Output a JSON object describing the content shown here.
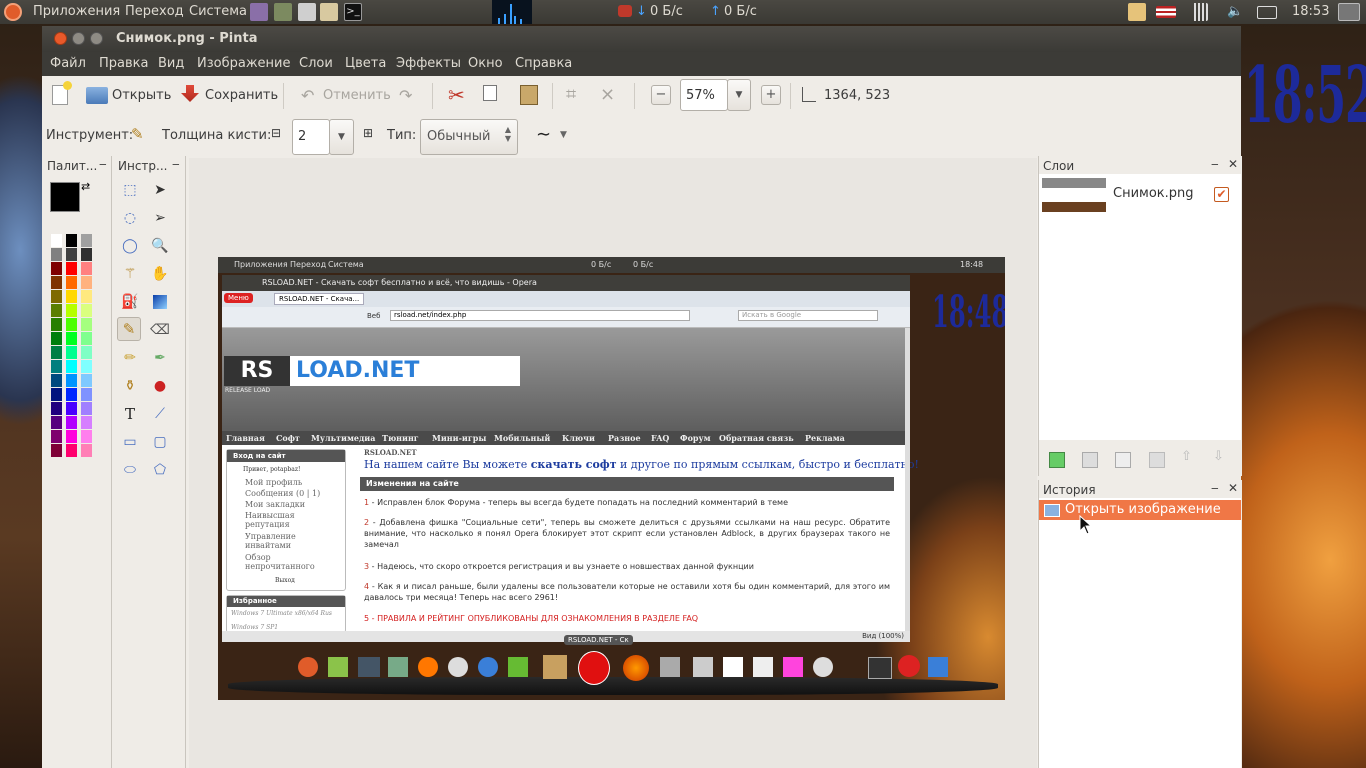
{
  "desktop": {
    "clock_widget": "18:52",
    "colors": {
      "panel": "#3c3b37",
      "accent": "#f07746"
    }
  },
  "top_panel": {
    "apps": "Приложения",
    "places": "Переход",
    "system": "Система",
    "net_down": "0 Б/с",
    "net_up": "0 Б/с",
    "time": "18:53"
  },
  "window": {
    "title": "Снимок.png - Pinta",
    "menu": [
      "Файл",
      "Правка",
      "Вид",
      "Изображение",
      "Слои",
      "Цвета",
      "Эффекты",
      "Окно",
      "Справка"
    ]
  },
  "toolbar": {
    "open": "Открыть",
    "save": "Сохранить",
    "undo": "Отменить",
    "zoom": "57%",
    "size": "1364, 523"
  },
  "toolbar2": {
    "tool_label": "Инструмент:",
    "brush_label": "Толщина кисти:",
    "brush_value": "2",
    "type_label": "Тип:",
    "type_value": "Обычный"
  },
  "panes": {
    "palette": "Палит...",
    "tools": "Инстр...",
    "layers": "Слои",
    "history": "История"
  },
  "layers": [
    {
      "name": "Снимок.png",
      "visible": true
    }
  ],
  "history": [
    {
      "label": "Открыть изображение",
      "selected": true
    }
  ],
  "screenshot": {
    "panel_apps": "Приложения",
    "panel_places": "Переход",
    "panel_system": "Система",
    "panel_net": "0 Б/с",
    "panel_net2": "0 Б/с",
    "panel_time": "18:48",
    "clock_widget": "18:48",
    "browser_title": "RSLOAD.NET - Скачать софт бесплатно и всё, что видишь - Opera",
    "menu_btn": "Меню",
    "tab": "RSLOAD.NET - Скача...",
    "address_label": "Веб",
    "address": "rsload.net/index.php",
    "search_placeholder": "Искать в Google",
    "logo_rs": "RS",
    "logo_rest": "LOAD.NET",
    "logo_sub": "RELEASE LOAD",
    "nav": [
      "Главная",
      "Софт",
      "Мультимедиа",
      "Тюнинг",
      "Мини-игры",
      "Мобильный",
      "Ключи",
      "Разное",
      "FAQ",
      "Форум",
      "Обратная связь",
      "Реклама"
    ],
    "login_head": "Вход на сайт",
    "greeting": "Привет, potapbaz!",
    "user_links": [
      "Мой профиль",
      "Сообщения (0 | 1)",
      "Мои закладки",
      "Наивысшая репутация",
      "Управление инвайтами",
      "Обзор непрочитанного"
    ],
    "logout": "Выход",
    "favorites": "Избранное",
    "fav_item": "Windows 7 Ultimate x86/x64 Rus",
    "fav_item2": "Windows 7 SP1",
    "site_name": "RSLOAD.NET",
    "tagline_a": "На нашем сайте Вы можете ",
    "tagline_b": "скачать софт",
    "tagline_c": " и другое по прямым ссылкам, быстро и бесплатно!",
    "changes_head": "Изменения на сайте",
    "news": [
      {
        "n": "1",
        "text": "Исправлен блок Форума - теперь вы всегда будете попадать на последний комментарий в теме"
      },
      {
        "n": "2",
        "text": "Добавлена фишка \"Социальные сети\", теперь вы сможете делиться с друзьями ссылками на наш ресурс. Обратите внимание, что насколько я понял Opera блокирует этот скрипт если установлен Adblock, в других браузерах такого не замечал"
      },
      {
        "n": "3",
        "text": "Надеюсь, что скоро откроется регистрация и вы узнаете о новшествах данной фукнции"
      },
      {
        "n": "4",
        "text": "Как я и писал раньше, были удалены все пользователи которые не оставили хотя бы один комментарий, для этого им давалось три месяца! Теперь нас всего 2961!"
      },
      {
        "n": "5",
        "text": "ПРАВИЛА И РЕЙТИНГ ОПУБЛИКОВАНЫ ДЛЯ ОЗНАКОМЛЕНИЯ В РАЗДЕЛЕ FAQ"
      }
    ],
    "status_zoom": "Вид (100%)",
    "dock_tooltip": "RSLOAD.NET - Ск"
  }
}
